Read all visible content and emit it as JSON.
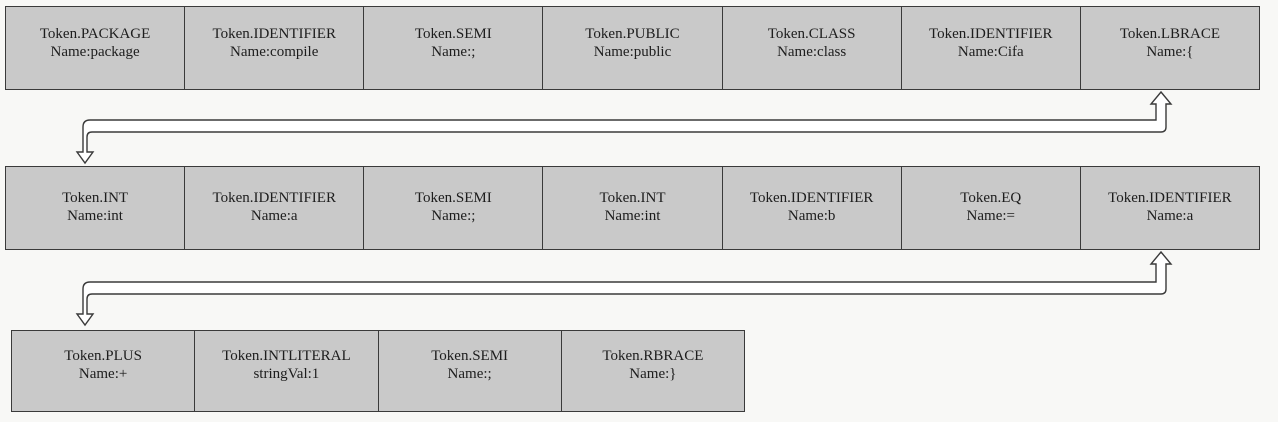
{
  "rows": [
    {
      "tokens": [
        {
          "type": "Token.PACKAGE",
          "name": "Name:package"
        },
        {
          "type": "Token.IDENTIFIER",
          "name": "Name:compile"
        },
        {
          "type": "Token.SEMI",
          "name": "Name:;"
        },
        {
          "type": "Token.PUBLIC",
          "name": "Name:public"
        },
        {
          "type": "Token.CLASS",
          "name": "Name:class"
        },
        {
          "type": "Token.IDENTIFIER",
          "name": "Name:Cifa"
        },
        {
          "type": "Token.LBRACE",
          "name": "Name:{"
        }
      ]
    },
    {
      "tokens": [
        {
          "type": "Token.INT",
          "name": "Name:int"
        },
        {
          "type": "Token.IDENTIFIER",
          "name": "Name:a"
        },
        {
          "type": "Token.SEMI",
          "name": "Name:;"
        },
        {
          "type": "Token.INT",
          "name": "Name:int"
        },
        {
          "type": "Token.IDENTIFIER",
          "name": "Name:b"
        },
        {
          "type": "Token.EQ",
          "name": "Name:="
        },
        {
          "type": "Token.IDENTIFIER",
          "name": "Name:a"
        }
      ]
    },
    {
      "tokens": [
        {
          "type": "Token.PLUS",
          "name": "Name:+"
        },
        {
          "type": "Token.INTLITERAL",
          "name": "stringVal:1"
        },
        {
          "type": "Token.SEMI",
          "name": "Name:;"
        },
        {
          "type": "Token.RBRACE",
          "name": "Name:}"
        }
      ]
    }
  ],
  "colors": {
    "cell_fill": "#c9c9c9",
    "border": "#3a3a3a",
    "arrow_fill": "#ffffff",
    "background": "#f8f8f6"
  }
}
